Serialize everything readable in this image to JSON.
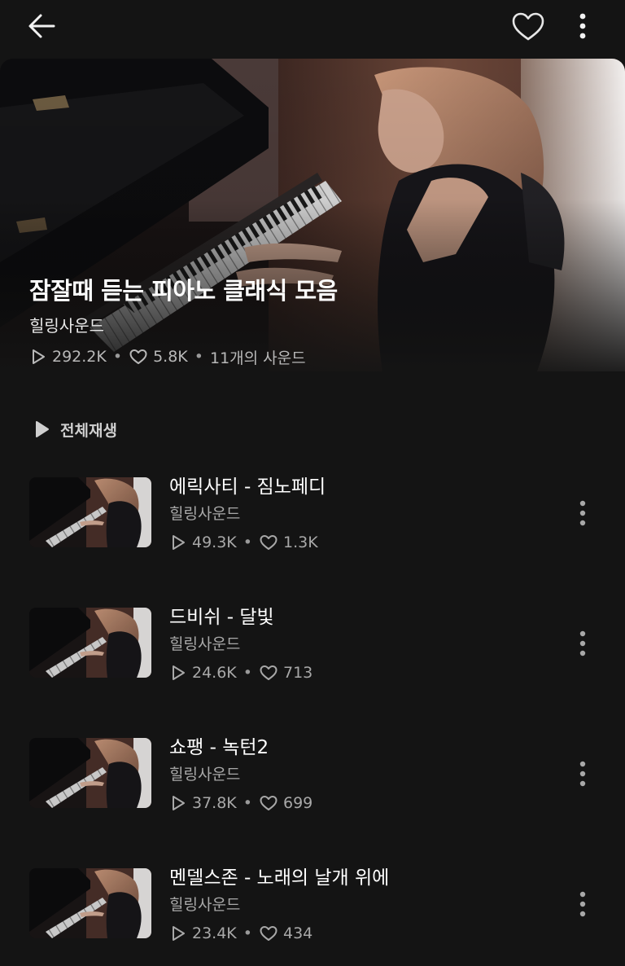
{
  "header": {
    "back_icon": "arrow-left-icon",
    "favorite_icon": "heart-outline-icon",
    "more_icon": "more-vertical-icon"
  },
  "playlist": {
    "title": "잠잘때 듣는 피아노 클래식 모음",
    "artist": "힐링사운드",
    "plays": "292.2K",
    "likes": "5.8K",
    "sound_count": "11개의 사운드"
  },
  "play_all": {
    "label": "전체재생"
  },
  "tracks": [
    {
      "title": "에릭사티 - 짐노페디",
      "artist": "힐링사운드",
      "plays": "49.3K",
      "likes": "1.3K"
    },
    {
      "title": "드비쉬 - 달빛",
      "artist": "힐링사운드",
      "plays": "24.6K",
      "likes": "713"
    },
    {
      "title": "쇼팽 - 녹턴2",
      "artist": "힐링사운드",
      "plays": "37.8K",
      "likes": "699"
    },
    {
      "title": "멘델스존 - 노래의 날개 위에",
      "artist": "힐링사운드",
      "plays": "23.4K",
      "likes": "434"
    }
  ],
  "colors": {
    "background": "#141414",
    "text_primary": "#ffffff",
    "text_secondary": "#a8a8a8"
  }
}
